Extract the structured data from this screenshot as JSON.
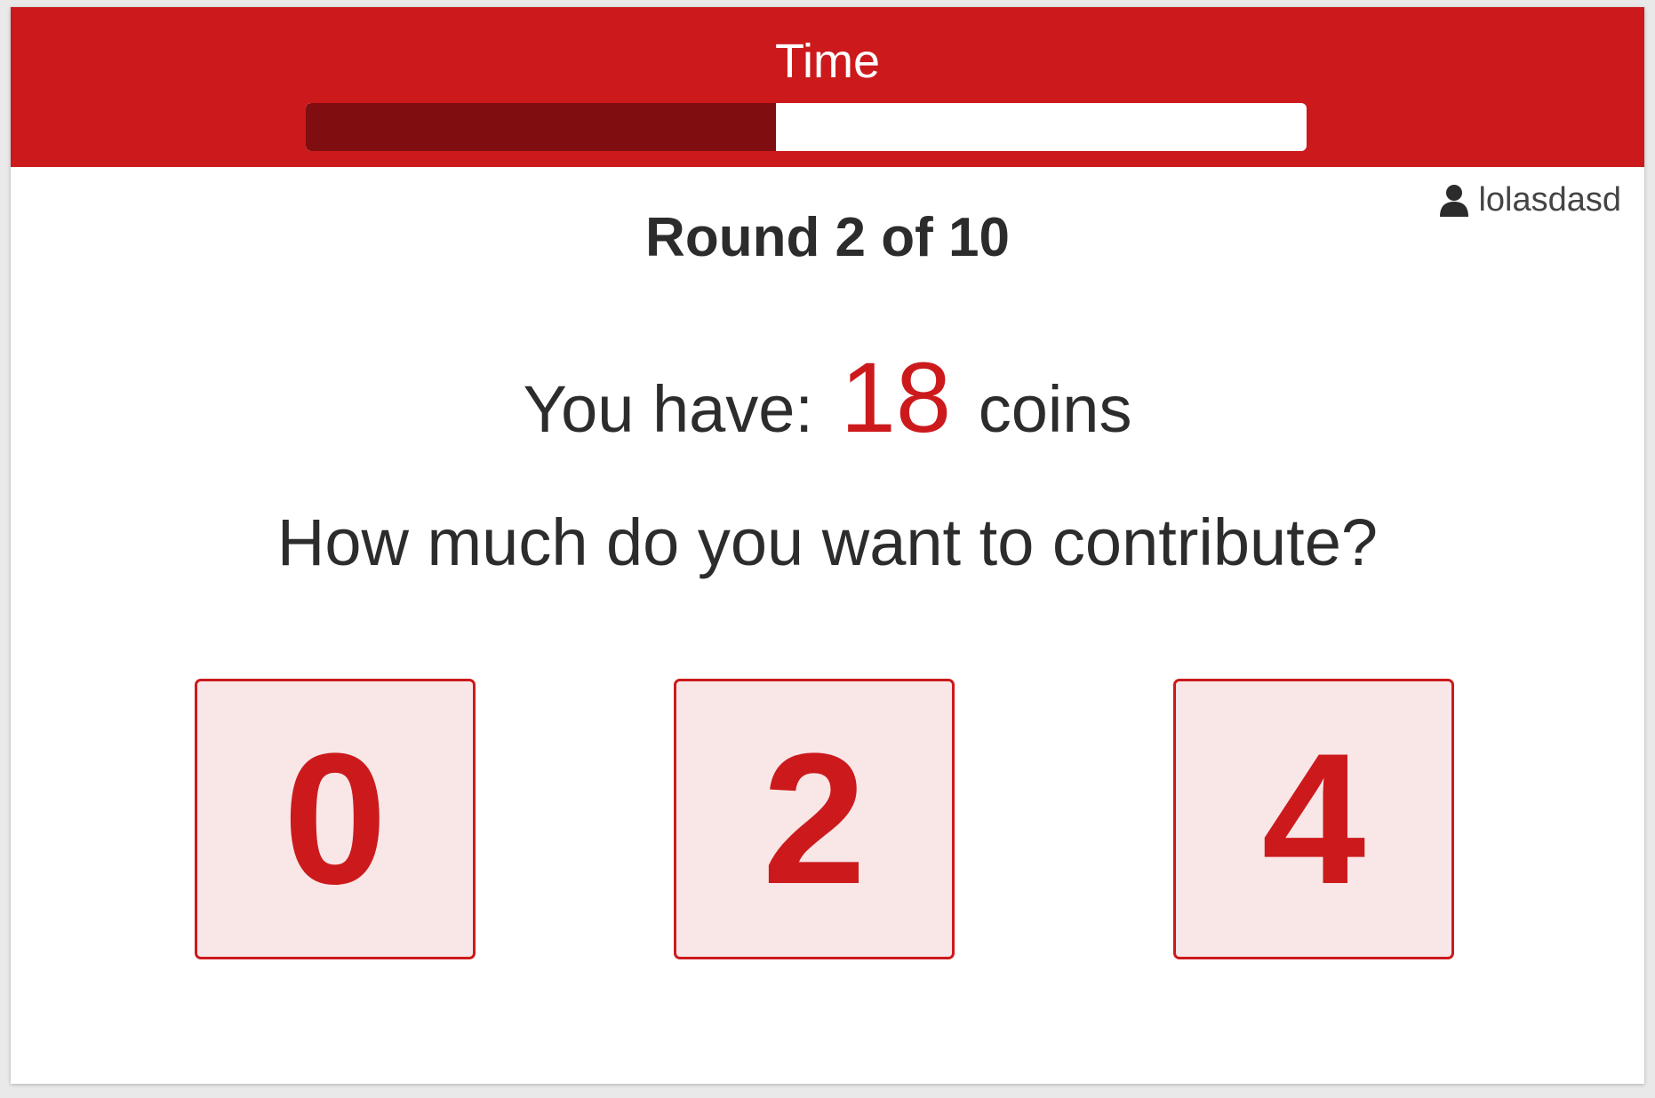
{
  "header": {
    "timer_label": "Time",
    "timer_progress": 0.47
  },
  "user": {
    "icon": "user-icon",
    "name": "lolasdasd"
  },
  "round": {
    "title": "Round 2 of 10"
  },
  "coins": {
    "prefix": "You have:",
    "value": "18",
    "suffix": "coins"
  },
  "question": {
    "text": "How much do you want to contribute?"
  },
  "options": [
    "0",
    "2",
    "4"
  ],
  "colors": {
    "accent": "#cc1a1c",
    "timer_fill": "#800d0f",
    "option_bg": "#f9e6e7"
  }
}
